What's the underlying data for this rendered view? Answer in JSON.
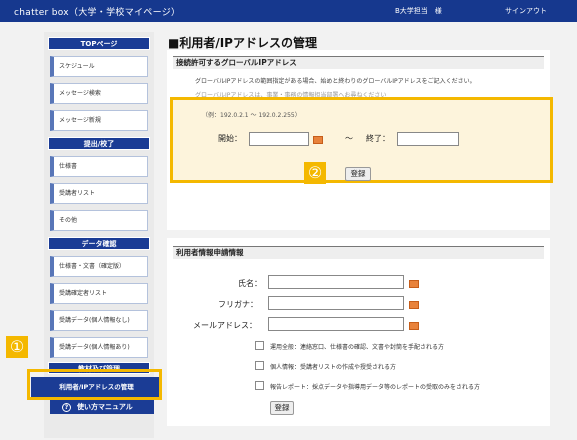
{
  "header": {
    "app_title": "chatter box（大学・学校マイページ）",
    "user_label": "B大学担当　様",
    "signout_label": "サインアウト"
  },
  "sidebar": {
    "sections": [
      {
        "title": "TOPページ",
        "items": [
          "スケジュール",
          "メッセージ検索",
          "メッセージ新規"
        ]
      },
      {
        "title": "提出/校了",
        "items": [
          "仕様書",
          "受講者リスト",
          "その他"
        ]
      },
      {
        "title": "データ確認",
        "items": [
          "仕様書・文書（確定版）",
          "受講確定者リスト",
          "受講データ(個人情報なし)",
          "受講データ(個人情報あり)"
        ]
      }
    ],
    "hidden_label": "教材及び管理",
    "active_item": "利用者/IPアドレスの管理",
    "help_label": "使い方マニュアル",
    "help_icon_glyph": "?"
  },
  "main": {
    "page_title": "■利用者/IPアドレスの管理",
    "ip_section": {
      "heading": "接続許可するグローバルIPアドレス",
      "description": "グローバルIPアドレスの範囲指定がある場合、始めと終わりのグローバルIPアドレスをご記入ください。",
      "description2": "グローバルIPアドレスは、事業・事務の情報担当部署へお尋ねください",
      "example": "（例：192.0.2.1 ～ 192.0.2.255）",
      "start_label": "開始：",
      "tilde": "～",
      "end_label": "終了：",
      "register_label": "登録"
    },
    "user_section": {
      "heading": "利用者情報申請情報",
      "name_label": "氏名：",
      "kana_label": "フリガナ：",
      "email_label": "メールアドレス：",
      "options": [
        "運用全般：連絡窓口、仕様書の確認、文書や封筒を手配される方",
        "個人情報：受講者リストの作成や授受される方",
        "報告レポート：採点データや指導用データ等のレポートの受取のみをされる方"
      ],
      "register_label": "登録"
    }
  },
  "callouts": {
    "one": "①",
    "two": "②"
  },
  "colors": {
    "header_bg": "#16388e",
    "accent": "#1b3c95",
    "highlight": "#f4b800",
    "highlight_fill": "#fdf4dc"
  }
}
